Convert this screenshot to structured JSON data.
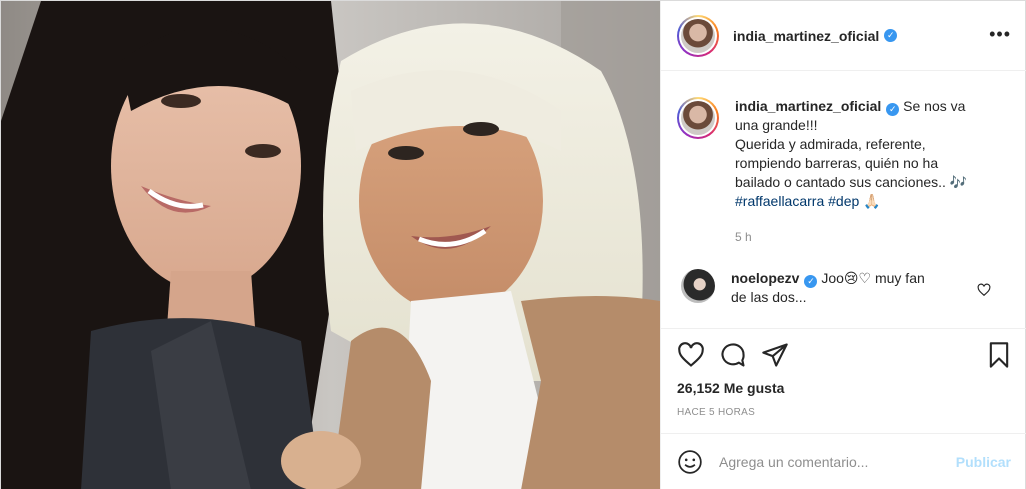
{
  "post": {
    "author": "india_martinez_oficial",
    "verified": true,
    "image_alt": "",
    "caption": {
      "lead": "Se nos va",
      "line1": "una grande!!!",
      "line2": "Querida y admirada, referente,",
      "line3": "rompiendo barreras, quién no ha",
      "line4": "bailado o cantado sus canciones.. 🎶",
      "hashtag1": "#raffaellacarra",
      "hashtag2": "#dep",
      "emoji": "🙏🏻",
      "time": "5 h"
    },
    "comments": [
      {
        "author": "noelopezv",
        "verified": true,
        "text_line1": "Joo😢♡  muy fan",
        "text_line2": "de las dos..."
      }
    ],
    "likes": "26,152 Me gusta",
    "date": "HACE 5 HORAS",
    "add_comment": {
      "placeholder": "Agrega un comentario...",
      "publish_label": "Publicar"
    },
    "icons": {
      "more": "more-options-icon",
      "like": "heart-icon",
      "comment": "comment-bubble-icon",
      "share": "paper-plane-icon",
      "save": "bookmark-icon",
      "emoji": "emoji-smile-icon",
      "verified": "verified-badge-icon"
    },
    "colors": {
      "accent": "#3897f0",
      "link": "#00376b",
      "publish_disabled": "#b2dffc",
      "muted": "#8e8e8e"
    }
  }
}
